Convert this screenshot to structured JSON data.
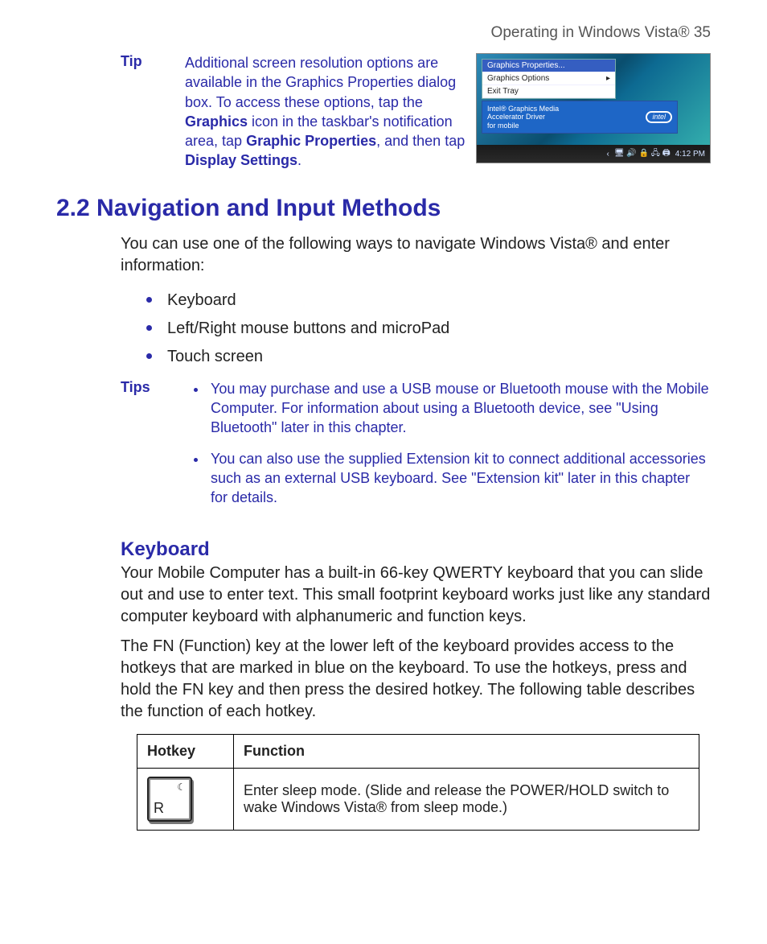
{
  "header": {
    "running_head": "Operating in Windows Vista®  35"
  },
  "tip1": {
    "label": "Tip",
    "text_pre": "Additional screen resolution options are available in the Graphics Properties dialog box. To access these options, tap the ",
    "bold1": "Graphics",
    "text_mid1": " icon in the taskbar's notification area, tap ",
    "bold2": "Graphic Properties",
    "text_mid2": ", and then tap ",
    "bold3": "Display Settings",
    "text_end": "."
  },
  "screenshot": {
    "menu_items": [
      "Graphics Properties...",
      "Graphics Options",
      "Exit Tray"
    ],
    "arrow": "▸",
    "bluebar_l1": "Intel® Graphics Media",
    "bluebar_l2": "Accelerator Driver",
    "bluebar_l3": "for mobile",
    "intel": "intel",
    "tray_caret": "‹",
    "tray_icons": "🖥 🔊 🔒  🖧 🖨",
    "clock": "4:12 PM"
  },
  "section": {
    "title": "2.2  Navigation and Input Methods",
    "intro": "You can use one of the following ways to navigate Windows Vista® and enter information:",
    "bullets": [
      "Keyboard",
      "Left/Right mouse buttons and microPad",
      "Touch screen"
    ]
  },
  "tips2": {
    "label": "Tips",
    "items": [
      "You may purchase and use a USB mouse or Bluetooth mouse with the Mobile Computer. For information about using a Bluetooth device, see \"Using Bluetooth\" later in this chapter.",
      "You can also use the supplied Extension kit to connect additional accessories such as an external USB keyboard. See \"Extension kit\" later in this chapter for details."
    ]
  },
  "keyboard": {
    "title": "Keyboard",
    "p1": "Your Mobile Computer has a built-in 66-key QWERTY keyboard that you can slide out and use to enter text. This small footprint keyboard works just like any standard computer keyboard with alphanumeric and function keys.",
    "p2": "The FN (Function) key at the lower left of the keyboard provides access to the hotkeys that are marked in blue on the keyboard. To use the hotkeys, press and hold the FN key and then press the desired hotkey. The following table describes the function of each hotkey."
  },
  "table": {
    "head_hotkey": "Hotkey",
    "head_function": "Function",
    "row1_key_main": "R",
    "row1_key_sub": "☾",
    "row1_func": "Enter sleep mode. (Slide and release the POWER/HOLD switch to wake Windows Vista® from sleep mode.)"
  }
}
